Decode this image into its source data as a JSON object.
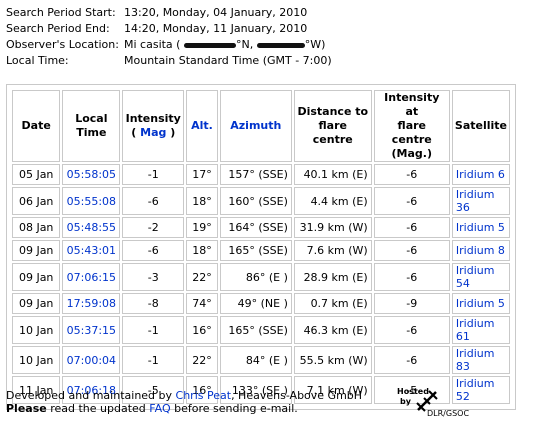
{
  "info": {
    "start_label": "Search Period Start:",
    "start_value": "13:20, Monday, 04 January, 2010",
    "end_label": "Search Period End:",
    "end_value": "14:20, Monday, 11 January, 2010",
    "location_label": "Observer's Location:",
    "location_prefix": "Mi casita (",
    "location_n": "°N,",
    "location_w": "°W)",
    "time_label": "Local Time:",
    "time_value": "Mountain Standard Time (GMT - 7:00)"
  },
  "table": {
    "headers": {
      "date": "Date",
      "local_time_1": "Local",
      "local_time_2": "Time",
      "intensity_1": "Intensity",
      "intensity_open": "(",
      "intensity_mag": "Mag",
      "intensity_close": ")",
      "alt": "Alt.",
      "azimuth": "Azimuth",
      "distance_1": "Distance to",
      "distance_2": "flare centre",
      "intensity_centre_1": "Intensity at",
      "intensity_centre_2": "flare centre",
      "intensity_centre_3": "(Mag.)",
      "satellite": "Satellite"
    },
    "rows": [
      {
        "date": "05 Jan",
        "time": "05:58:05",
        "intensity": "-1",
        "alt": "17°",
        "azimuth": "157° (SSE)",
        "distance": "40.1 km (E)",
        "centre": "-6",
        "satellite": "Iridium 6"
      },
      {
        "date": "06 Jan",
        "time": "05:55:08",
        "intensity": "-6",
        "alt": "18°",
        "azimuth": "160° (SSE)",
        "distance": "4.4 km (E)",
        "centre": "-6",
        "satellite": "Iridium 36"
      },
      {
        "date": "08 Jan",
        "time": "05:48:55",
        "intensity": "-2",
        "alt": "19°",
        "azimuth": "164° (SSE)",
        "distance": "31.9 km (W)",
        "centre": "-6",
        "satellite": "Iridium 5"
      },
      {
        "date": "09 Jan",
        "time": "05:43:01",
        "intensity": "-6",
        "alt": "18°",
        "azimuth": "165° (SSE)",
        "distance": "7.6 km (W)",
        "centre": "-6",
        "satellite": "Iridium 8"
      },
      {
        "date": "09 Jan",
        "time": "07:06:15",
        "intensity": "-3",
        "alt": "22°",
        "azimuth": "86° (E )",
        "distance": "28.9 km (E)",
        "centre": "-6",
        "satellite": "Iridium 54"
      },
      {
        "date": "09 Jan",
        "time": "17:59:08",
        "intensity": "-8",
        "alt": "74°",
        "azimuth": "49° (NE )",
        "distance": "0.7 km (E)",
        "centre": "-9",
        "satellite": "Iridium 5"
      },
      {
        "date": "10 Jan",
        "time": "05:37:15",
        "intensity": "-1",
        "alt": "16°",
        "azimuth": "165° (SSE)",
        "distance": "46.3 km (E)",
        "centre": "-6",
        "satellite": "Iridium 61"
      },
      {
        "date": "10 Jan",
        "time": "07:00:04",
        "intensity": "-1",
        "alt": "22°",
        "azimuth": "84° (E )",
        "distance": "55.5 km (W)",
        "centre": "-6",
        "satellite": "Iridium 83"
      },
      {
        "date": "11 Jan",
        "time": "07:06:18",
        "intensity": "-5",
        "alt": "16°",
        "azimuth": "133° (SE )",
        "distance": "7.1 km (W)",
        "centre": "-5",
        "satellite": "Iridium 52"
      }
    ]
  },
  "footer": {
    "line1_a": "Developed and maintained by ",
    "author_link": "Chris Peat",
    "line1_b": ", Heavens-Above GmbH",
    "please": "Please",
    "line2_a": " read the updated ",
    "faq_link": "FAQ",
    "line2_b": " before sending e-mail."
  },
  "logo": {
    "hosted": "Hosted",
    "by": "by",
    "org": "DLR/GSOC"
  },
  "colors": {
    "link": "#0033cc",
    "border": "#c9c9c9"
  }
}
